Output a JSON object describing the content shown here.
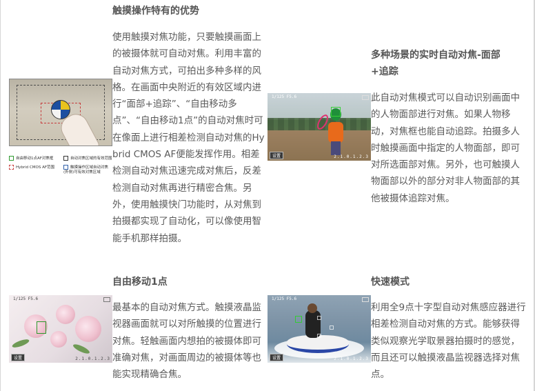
{
  "section1": {
    "title": "触摸操作特有的优势",
    "body": "使用触摸对焦功能，只要触摸画面上的被摄体就可自动对焦。利用丰富的自动对焦方式，可拍出多种多样的风格。在画面中央附近的有效区域内进行“面部+追踪”、“自由移动多点”、“自由移动1点”的自动对焦时可在像面上进行相差检测自动对焦的Hybrid CMOS AF便能发挥作用。相差检测自动对焦迅速完成对焦后，反差检测自动对焦再进行精密合焦。另外，使用触摸快门功能时，从对焦到拍摄都实现了自动化，可以像使用智能手机那样拍摄。",
    "legend": [
      {
        "label": "自由移动1点AF对焦框",
        "color": "#2e9a2e"
      },
      {
        "label": "自动对焦区域的有效范围",
        "color": "#333333"
      },
      {
        "label": "Hybrid CMOS AF范围",
        "color": "#c63a3a"
      },
      {
        "label": "触摸操作区域自动对焦(外侧)可有效对焦区域",
        "color": "#2f5fa8"
      }
    ]
  },
  "section2": {
    "title": "多种场景的实时自动对焦-面部+追踪",
    "body": "此自动对焦模式可以自动识别画面中的人物面部进行对焦。如果人物移动，对焦框也能自动追踪。拍摄多人时触摸画面中指定的人物面部，即可对所选面部对焦。另外，也可触摸人物面部以外的部分对非人物面部的其他被摄体追踪对焦。"
  },
  "section3": {
    "title": "自由移动1点",
    "body": "最基本的自动对焦方式。触摸液晶监视器画面就可以对所触摸的位置进行对焦。轻触画面内想拍的被摄体即可准确对焦，对画面周边的被摄体等也能实现精确合焦。"
  },
  "section4": {
    "title": "快速模式",
    "body": "利用全9点十字型自动对焦感应器进行相差检测自动对焦的方式。能够获得类似观察光学取景器拍摄时的感觉，而且还可以触摸液晶监视器选择对焦点。"
  },
  "hud": {
    "top_readout": "1/125 F5.6",
    "bottom_left_label": "设置",
    "bottom_right_readout": "2.1.0.1.2.3"
  },
  "colors": {
    "title_text": "#555555",
    "body_text": "#5a5a5a",
    "af_frame_green": "#36d036",
    "hybrid_range_red": "#c63a3a"
  }
}
